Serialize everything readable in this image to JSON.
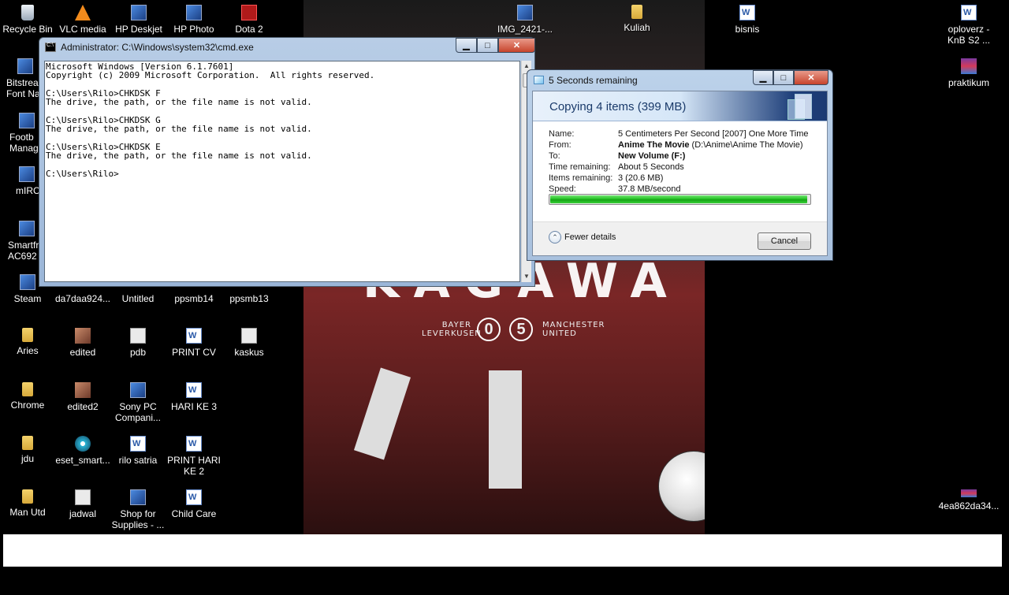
{
  "desktop_icons": [
    {
      "label": "Recycle Bin",
      "icon": "recycle-bin-icon"
    },
    {
      "label": "VLC media",
      "icon": "vlc-cone-icon"
    },
    {
      "label": "HP Deskjet",
      "icon": "printer-app-icon"
    },
    {
      "label": "HP Photo",
      "icon": "photo-app-icon"
    },
    {
      "label": "Dota 2",
      "icon": "dota-icon"
    },
    {
      "label": "IMG_2421-...",
      "icon": "image-file-icon"
    },
    {
      "label": "Kuliah",
      "icon": "folder-icon"
    },
    {
      "label": "bisnis",
      "icon": "word-doc-icon"
    },
    {
      "label": "oploverz - KnB S2 ...",
      "icon": "file-icon"
    },
    {
      "label": "Bitstrea Font Na",
      "icon": "app-icon"
    },
    {
      "label": "praktikum",
      "icon": "rar-archive-icon"
    },
    {
      "label": "Footb Manag",
      "icon": "app-icon"
    },
    {
      "label": "mIRC",
      "icon": "app-icon"
    },
    {
      "label": "Smartfr AC692",
      "icon": "app-icon"
    },
    {
      "label": "Steam",
      "icon": "steam-icon"
    },
    {
      "label": "da7daa924...",
      "icon": "file-icon"
    },
    {
      "label": "Untitled",
      "icon": "file-icon"
    },
    {
      "label": "ppsmb14",
      "icon": "file-icon"
    },
    {
      "label": "ppsmb13",
      "icon": "file-icon"
    },
    {
      "label": "Aries",
      "icon": "folder-icon"
    },
    {
      "label": "edited",
      "icon": "image-file-icon"
    },
    {
      "label": "pdb",
      "icon": "blank-file-icon"
    },
    {
      "label": "PRINT CV",
      "icon": "word-doc-icon"
    },
    {
      "label": "kaskus",
      "icon": "shortcut-icon"
    },
    {
      "label": "Chrome",
      "icon": "folder-icon"
    },
    {
      "label": "edited2",
      "icon": "image-file-icon"
    },
    {
      "label": "Sony PC Compani...",
      "icon": "app-icon"
    },
    {
      "label": "HARI KE 3",
      "icon": "word-doc-icon"
    },
    {
      "label": "jdu",
      "icon": "folder-icon"
    },
    {
      "label": "eset_smart...",
      "icon": "disc-icon"
    },
    {
      "label": "rilo satria",
      "icon": "word-doc-icon"
    },
    {
      "label": "PRINT HARI KE 2",
      "icon": "word-doc-icon"
    },
    {
      "label": "Man Utd",
      "icon": "folder-icon"
    },
    {
      "label": "jadwal",
      "icon": "blank-file-icon"
    },
    {
      "label": "Shop for Supplies - ...",
      "icon": "app-icon"
    },
    {
      "label": "Child Care",
      "icon": "word-doc-icon"
    },
    {
      "label": "4ea862da34...",
      "icon": "file-icon"
    }
  ],
  "wallpaper": {
    "title": "KAGAWA",
    "team_left": "BAYER\nLEVERKUSEN",
    "score_left": "0",
    "score_right": "5",
    "team_right": "MANCHESTER\nUNITED"
  },
  "cmd": {
    "title": "Administrator: C:\\Windows\\system32\\cmd.exe",
    "minimize": "▁",
    "maximize": "□",
    "close": "✕",
    "lines": [
      "Microsoft Windows [Version 6.1.7601]",
      "Copyright (c) 2009 Microsoft Corporation.  All rights reserved.",
      "",
      "C:\\Users\\Rilo>CHKDSK F",
      "The drive, the path, or the file name is not valid.",
      "",
      "C:\\Users\\Rilo>CHKDSK G",
      "The drive, the path, or the file name is not valid.",
      "",
      "C:\\Users\\Rilo>CHKDSK E",
      "The drive, the path, or the file name is not valid.",
      "",
      "C:\\Users\\Rilo>"
    ]
  },
  "copy_dialog": {
    "title": "5 Seconds remaining",
    "heading": "Copying 4 items (399 MB)",
    "name_label": "Name:",
    "name_value": "5 Centimeters Per Second [2007] One More Time",
    "from_label": "From:",
    "from_bold": "Anime The Movie",
    "from_rest": " (D:\\Anime\\Anime The Movie)",
    "to_label": "To:",
    "to_value": "New Volume (F:)",
    "time_label": "Time remaining:",
    "time_value": "About 5 Seconds",
    "items_label": "Items remaining:",
    "items_value": "3 (20.6 MB)",
    "speed_label": "Speed:",
    "speed_value": "37.8 MB/second",
    "progress_percent": 99,
    "fewer_details": "Fewer details",
    "cancel": "Cancel"
  }
}
